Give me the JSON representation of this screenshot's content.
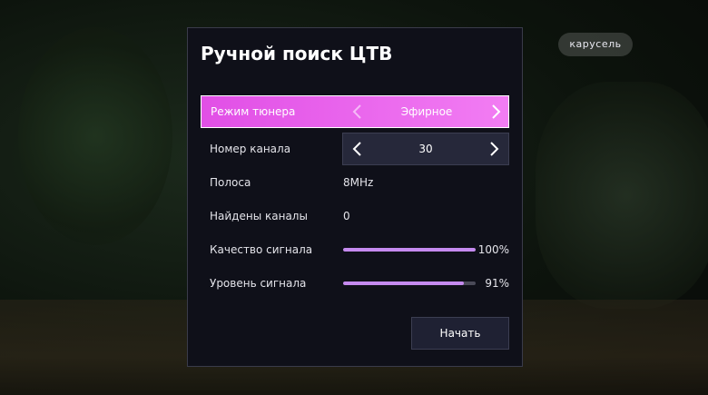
{
  "brand": {
    "logo_text": "карусель"
  },
  "dialog": {
    "title": "Ручной поиск ЦТВ",
    "tuner_mode": {
      "label": "Режим тюнера",
      "value": "Эфирное"
    },
    "channel_number": {
      "label": "Номер канала",
      "value": "30"
    },
    "band": {
      "label": "Полоса",
      "value": "8MHz"
    },
    "found_channels": {
      "label": "Найдены каналы",
      "value": "0"
    },
    "signal_quality": {
      "label": "Качество сигнала",
      "percent_text": "100%",
      "level": 1.0
    },
    "signal_level": {
      "label": "Уровень сигнала",
      "percent_text": "91%",
      "level": 0.91
    },
    "start_button": "Начать"
  },
  "colors": {
    "accent_pink": "#e14fe6",
    "bar_fill": "#c58aef",
    "panel_bg": "#0f1019"
  },
  "icons": {
    "arrow_left": "chevron-left-icon",
    "arrow_right": "chevron-right-icon"
  }
}
